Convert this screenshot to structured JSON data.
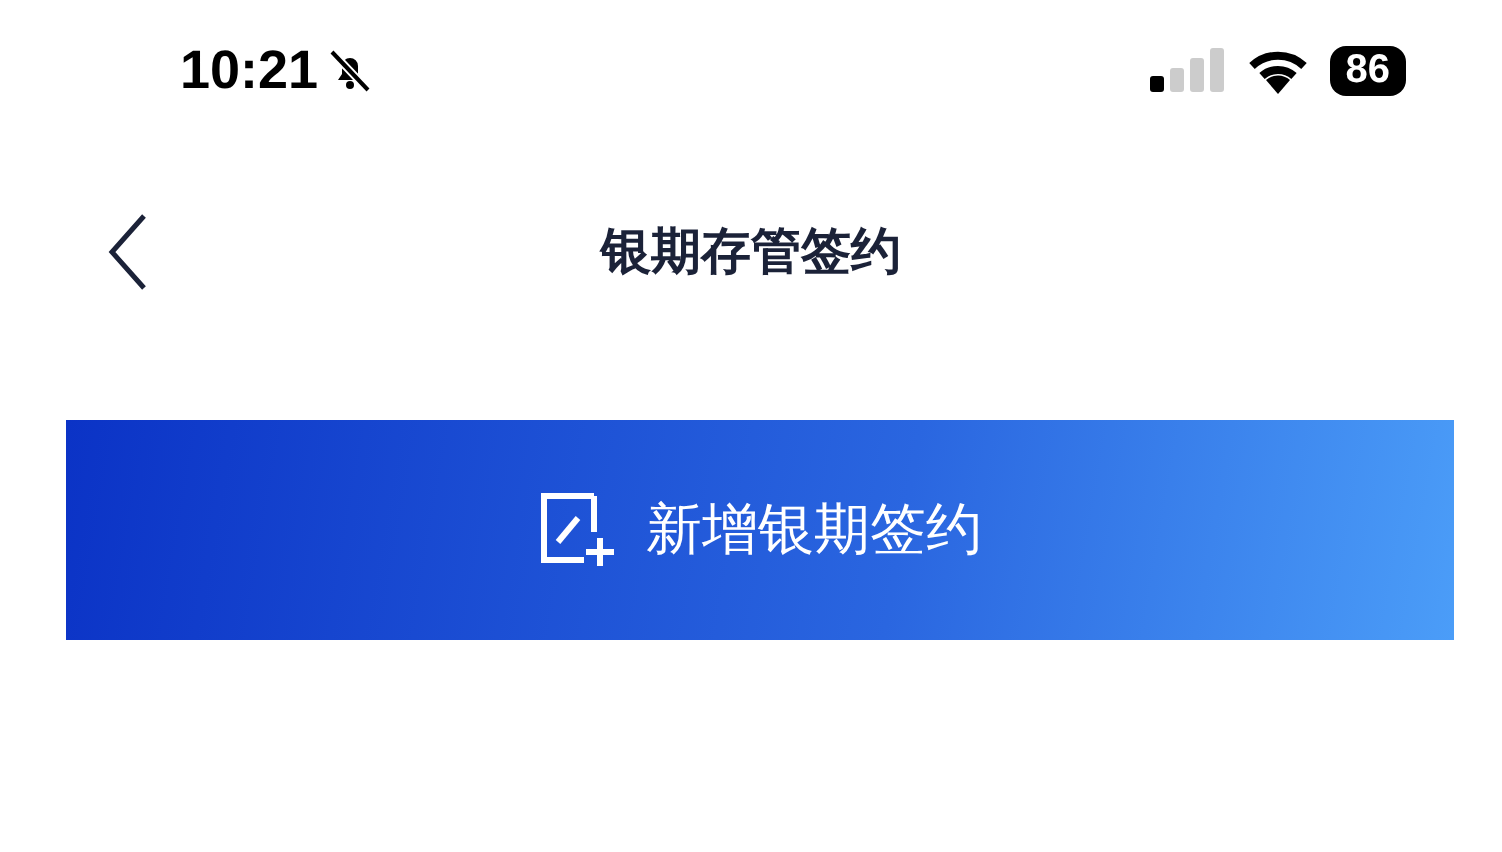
{
  "status_bar": {
    "time": "10:21",
    "battery": "86"
  },
  "nav": {
    "title": "银期存管签约"
  },
  "add_button": {
    "label": "新增银期签约"
  }
}
